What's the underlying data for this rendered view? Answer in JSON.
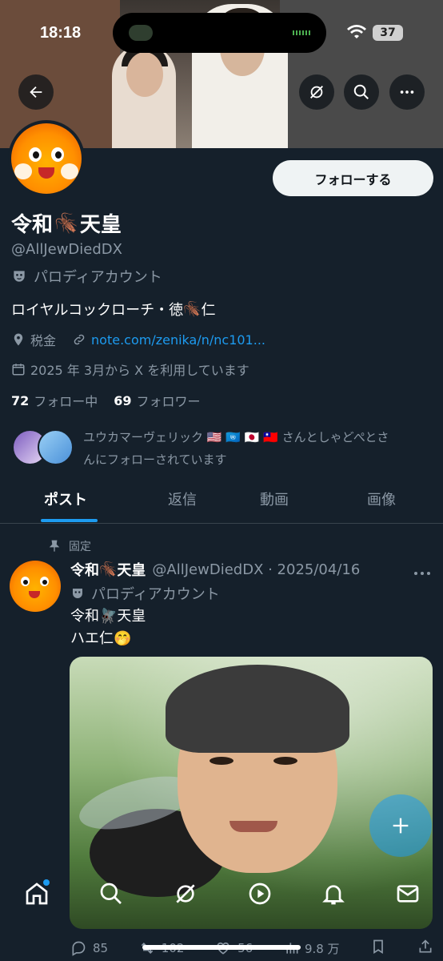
{
  "status_bar": {
    "time": "18:18",
    "battery": "37"
  },
  "header": {
    "back_icon": "arrow-left-icon",
    "grok_icon": "grok-icon",
    "search_icon": "search-icon",
    "more_icon": "more-icon"
  },
  "profile": {
    "display_name_1": "令和",
    "display_name_emoji": "🪳",
    "display_name_2": "天皇",
    "handle": "@AllJewDiedDX",
    "parody_label": "パロディアカウント",
    "bio_1": "ロイヤルコックローチ・徳",
    "bio_emoji": "🪳",
    "bio_2": "仁",
    "location": "税金",
    "website": "note.com/zenika/n/nc101...",
    "joined": "2025 年 3月から X を利用しています",
    "following_count": "72",
    "following_label": "フォロー中",
    "followers_count": "69",
    "followers_label": "フォロワー",
    "followed_by_1": "ユウカマーヴェリック",
    "followed_by_flags": [
      "🇺🇸",
      "🇺🇳",
      "🇯🇵",
      "🇹🇼"
    ],
    "followed_by_2": "さんとしゃどぺとさ",
    "followed_by_3": "んにフォローされています",
    "follow_button": "フォローする"
  },
  "tabs": [
    {
      "label": "ポスト",
      "active": true
    },
    {
      "label": "返信",
      "active": false
    },
    {
      "label": "動画",
      "active": false
    },
    {
      "label": "画像",
      "active": false
    }
  ],
  "tweet": {
    "pinned_label": "固定",
    "author_1": "令和",
    "author_emoji": "🪳",
    "author_2": "天皇",
    "handle_date": "@AllJewDiedDX · 2025/04/16",
    "parody_label": "パロディアカウント",
    "text_line1_a": "令和",
    "text_line1_emoji": "🪰",
    "text_line1_b": "天皇",
    "text_line2": "ハエ仁",
    "text_line2_emoji": "🤭",
    "replies": "85",
    "retweets": "102",
    "likes": "56",
    "views": "9.8 万"
  },
  "colors": {
    "background": "#15202b",
    "accent": "#1d9bf0",
    "muted": "#8b98a5",
    "divider": "#38444d"
  },
  "nav": [
    "home-icon",
    "search-icon",
    "grok-icon",
    "spaces-icon",
    "notifications-icon",
    "messages-icon"
  ]
}
